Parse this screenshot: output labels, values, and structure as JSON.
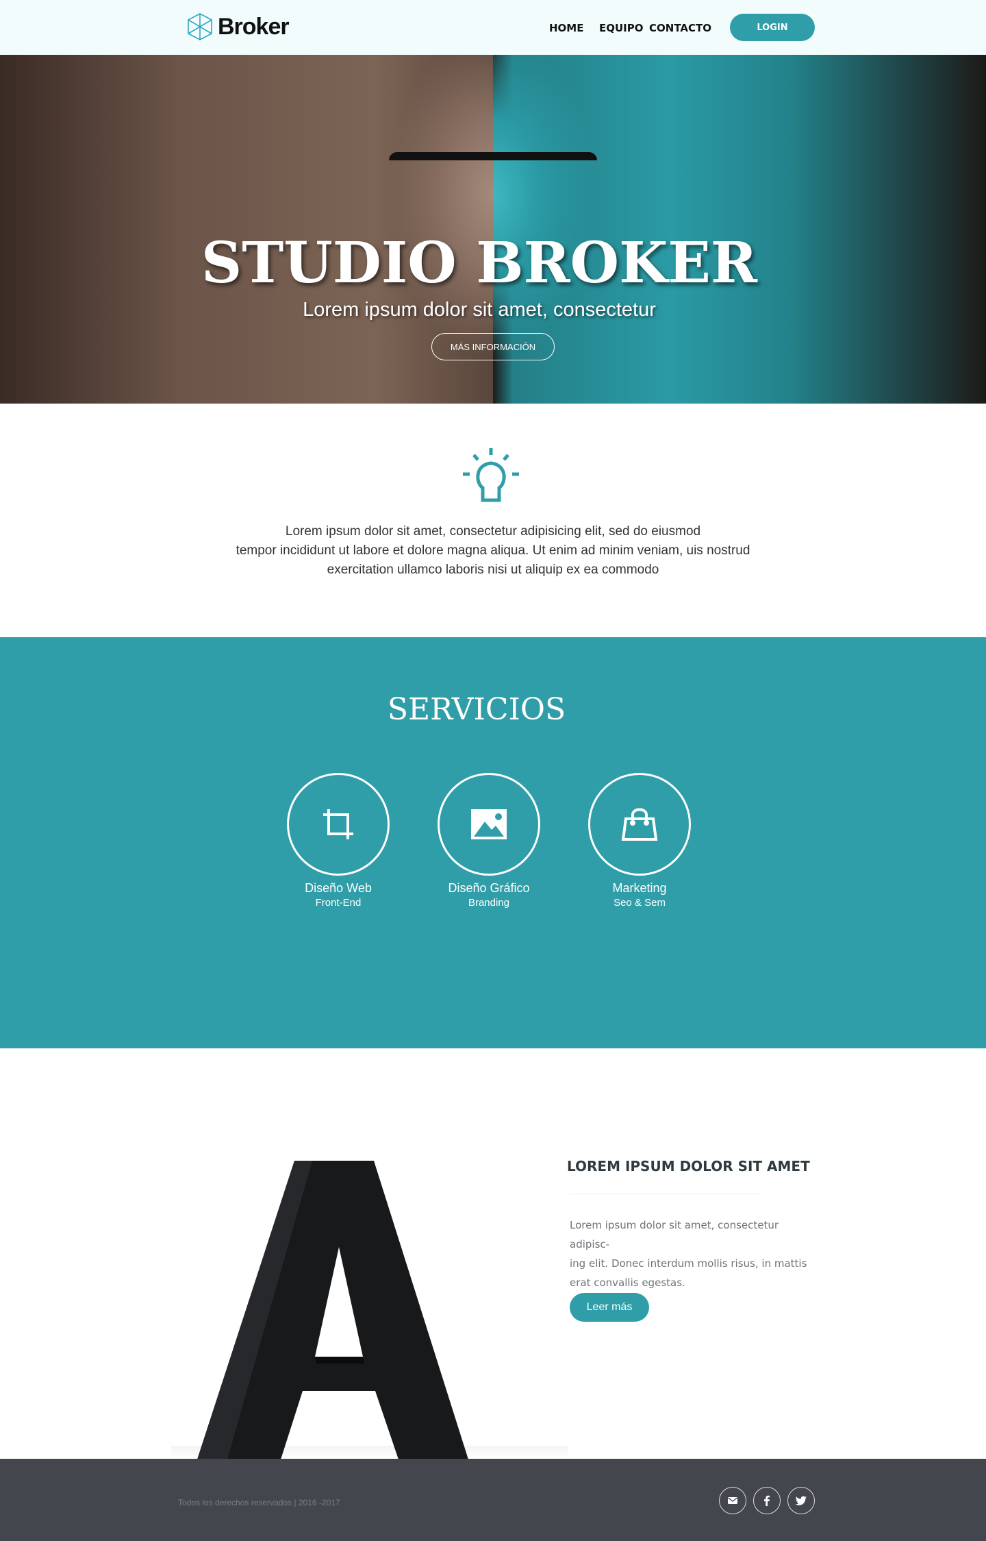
{
  "nav": {
    "brand": "Broker",
    "links": [
      "HOME",
      "EQUIPO",
      "CONTACTO"
    ],
    "login": "LOGIN"
  },
  "hero": {
    "title": "STUDIO BROKER",
    "subtitle": "Lorem ipsum dolor sit amet, consectetur",
    "button": "MÁS INFORMACIÓN"
  },
  "intro": {
    "icon": "lightbulb-icon",
    "lines": [
      "Lorem ipsum dolor sit amet, consectetur adipisicing elit, sed do eiusmod",
      "tempor incididunt ut labore et dolore magna aliqua. Ut enim ad minim veniam, uis nostrud",
      "exercitation ullamco laboris nisi ut aliquip ex ea commodo"
    ]
  },
  "services": {
    "title": "SERVICIOS",
    "items": [
      {
        "icon": "crop-icon",
        "title": "Diseño Web",
        "subtitle": "Front-End"
      },
      {
        "icon": "image-icon",
        "title": "Diseño Gráfico",
        "subtitle": "Branding"
      },
      {
        "icon": "shopping-bag-icon",
        "title": "Marketing",
        "subtitle": "Seo & Sem"
      }
    ]
  },
  "feature": {
    "title": "LOREM IPSUM DOLOR SIT AMET",
    "lines": [
      "Lorem ipsum dolor sit amet, consectetur adipisc-",
      "ing elit. Donec interdum mollis risus, in mattis",
      "erat convallis egestas."
    ],
    "button": "Leer más"
  },
  "footer": {
    "copyright": "Todos los derechos reservados | 2016 -2017",
    "social": [
      "mail-icon",
      "facebook-icon",
      "twitter-icon"
    ]
  },
  "colors": {
    "accent": "#2f9ea8",
    "nav_bg": "#f2fcfc",
    "footer_bg": "#43474d"
  }
}
